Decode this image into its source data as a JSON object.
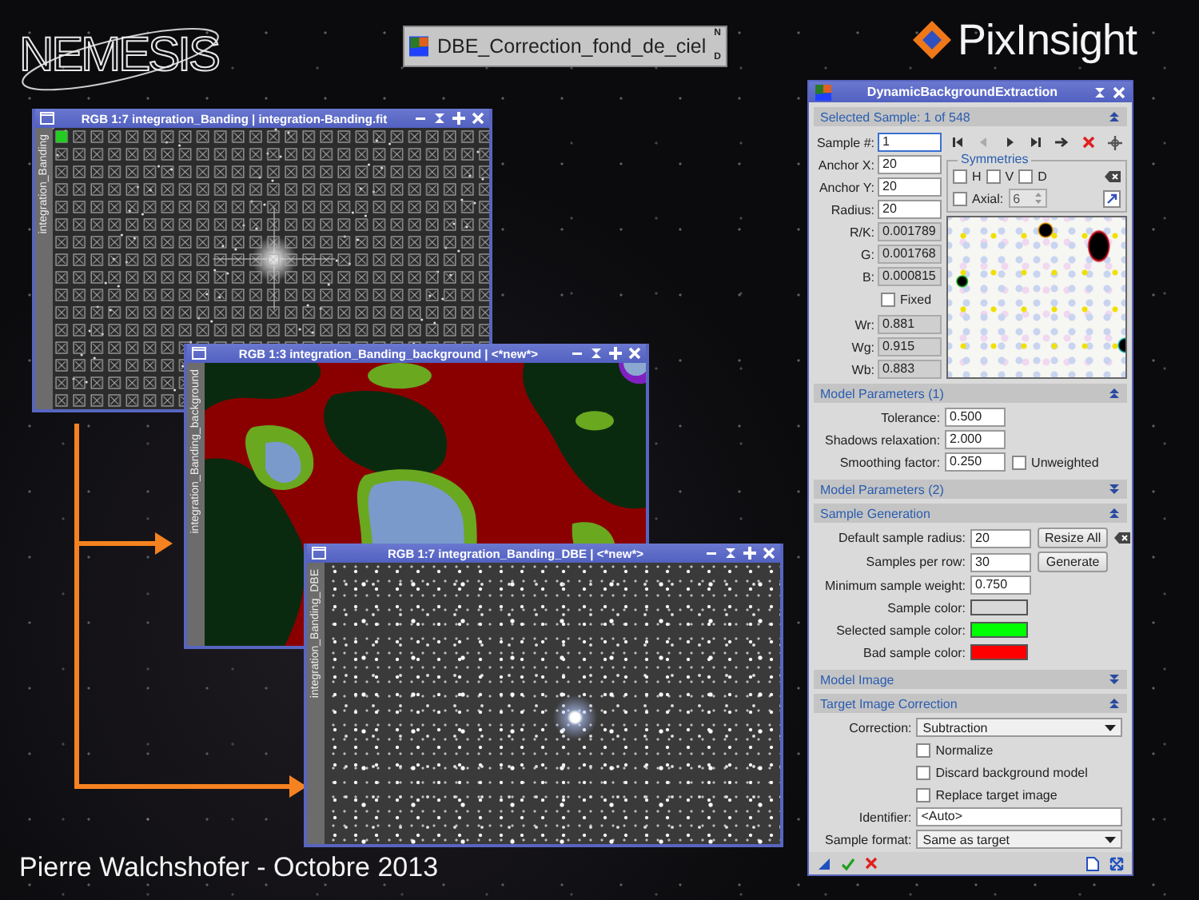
{
  "logo": {
    "text": "NEMESIS"
  },
  "process_icon": {
    "label": "DBE_Correction_fond_de_ciel",
    "flags": [
      "N",
      "D"
    ]
  },
  "brand": {
    "text": "PixInsight"
  },
  "image_windows": [
    {
      "title": "RGB 1:7 integration_Banding | integration-Banding.fit",
      "side_label": "integration_Banding",
      "kind": "sample-grid"
    },
    {
      "title": "RGB 1:3 integration_Banding_background | <*new*>",
      "side_label": "integration_Banding_background",
      "kind": "background-model"
    },
    {
      "title": "RGB 1:7 integration_Banding_DBE | <*new*>",
      "side_label": "integration_Banding_DBE",
      "kind": "star-field"
    }
  ],
  "dbe_panel": {
    "title": "DynamicBackgroundExtraction",
    "selected_sample": {
      "header": "Selected Sample: 1 of 548",
      "expanded": true,
      "fields": [
        {
          "label": "Sample #:",
          "value": "1"
        },
        {
          "label": "Anchor X:",
          "value": "20"
        },
        {
          "label": "Anchor Y:",
          "value": "20"
        },
        {
          "label": "Radius:",
          "value": "20"
        }
      ],
      "readings": [
        {
          "label": "R/K:",
          "value": "0.001789"
        },
        {
          "label": "G:",
          "value": "0.001768"
        },
        {
          "label": "B:",
          "value": "0.000815"
        }
      ],
      "fixed": {
        "label": "Fixed",
        "checked": false
      },
      "weights": [
        {
          "label": "Wr:",
          "value": "0.881"
        },
        {
          "label": "Wg:",
          "value": "0.915"
        },
        {
          "label": "Wb:",
          "value": "0.883"
        }
      ],
      "symmetries": {
        "title": "Symmetries",
        "options": [
          {
            "label": "H",
            "checked": false
          },
          {
            "label": "V",
            "checked": false
          },
          {
            "label": "D",
            "checked": false
          }
        ],
        "axial": {
          "label": "Axial:",
          "checked": false,
          "value": "6"
        }
      }
    },
    "sections": [
      {
        "header": "Model Parameters (1)",
        "expanded": true,
        "rows": [
          {
            "kind": "number",
            "label": "Tolerance:",
            "value": "0.500"
          },
          {
            "kind": "number",
            "label": "Shadows relaxation:",
            "value": "2.000"
          },
          {
            "kind": "number",
            "label": "Smoothing factor:",
            "value": "0.250",
            "checkbox": {
              "label": "Unweighted",
              "checked": false
            }
          }
        ]
      },
      {
        "header": "Model Parameters (2)",
        "expanded": false
      },
      {
        "header": "Sample Generation",
        "expanded": true,
        "rows": [
          {
            "kind": "number",
            "label": "Default sample radius:",
            "value": "20",
            "button": "Resize All"
          },
          {
            "kind": "number",
            "label": "Samples per row:",
            "value": "30",
            "button": "Generate"
          },
          {
            "kind": "number",
            "label": "Minimum sample weight:",
            "value": "0.750"
          },
          {
            "kind": "color",
            "label": "Sample color:",
            "color": "#d8d8d8"
          },
          {
            "kind": "color",
            "label": "Selected sample color:",
            "color": "#00ff00"
          },
          {
            "kind": "color",
            "label": "Bad sample color:",
            "color": "#ff0000"
          }
        ]
      },
      {
        "header": "Model Image",
        "expanded": false
      },
      {
        "header": "Target Image Correction",
        "expanded": true,
        "rows": [
          {
            "kind": "select",
            "label": "Correction:",
            "value": "Subtraction"
          },
          {
            "kind": "checkbox",
            "label": "Normalize",
            "checked": false
          },
          {
            "kind": "checkbox",
            "label": "Discard background model",
            "checked": false
          },
          {
            "kind": "checkbox",
            "label": "Replace target image",
            "checked": false
          },
          {
            "kind": "text",
            "label": "Identifier:",
            "value": "<Auto>"
          },
          {
            "kind": "select",
            "label": "Sample format:",
            "value": "Same as target"
          }
        ]
      }
    ]
  },
  "credit": "Pierre Walchshofer - Octobre 2013"
}
